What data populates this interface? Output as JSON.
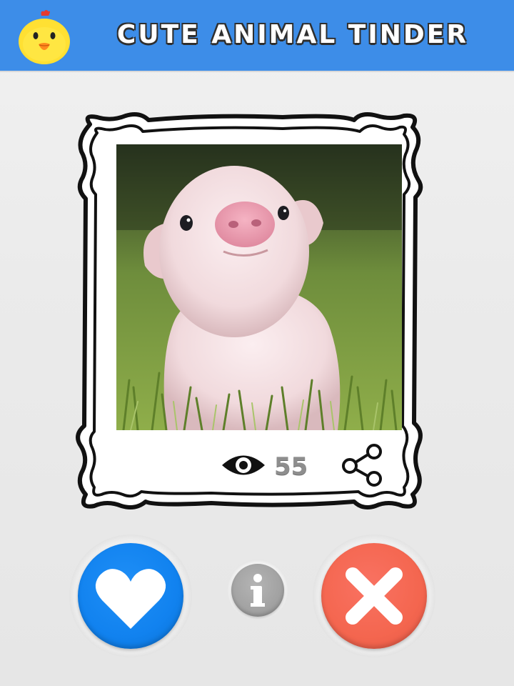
{
  "header": {
    "title": "CUTE ANIMAL TINDER",
    "logo_icon": "chick-icon",
    "background_color": "#3d8de8"
  },
  "card": {
    "photo_subject": "piglet",
    "view_count": "55",
    "view_icon": "eye-icon",
    "share_icon": "share-icon"
  },
  "actions": {
    "like_icon": "heart-icon",
    "like_color": "#1182ef",
    "info_icon": "info-icon",
    "info_color": "#a2a2a2",
    "dislike_icon": "close-icon",
    "dislike_color": "#f4664f"
  }
}
